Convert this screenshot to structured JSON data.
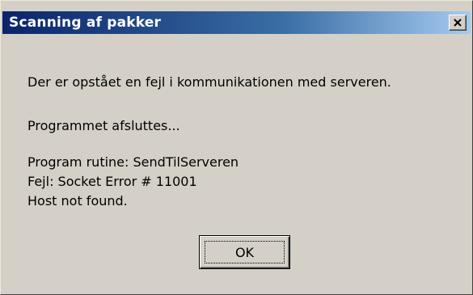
{
  "dialog": {
    "title": "Scanning af pakker",
    "close_icon": "close-icon",
    "ok_label": "OK"
  },
  "message": {
    "line1": "Der er opstået en fejl i kommunikationen med serveren.",
    "line2": "Programmet afsluttes...",
    "line3": "Program rutine: SendTilServeren",
    "line4": "Fejl: Socket Error # 11001",
    "line5": "Host not found."
  },
  "colors": {
    "titlebar_start": "#0a246a",
    "titlebar_end": "#a6caf0",
    "dialog_background": "#d4d0c8"
  }
}
